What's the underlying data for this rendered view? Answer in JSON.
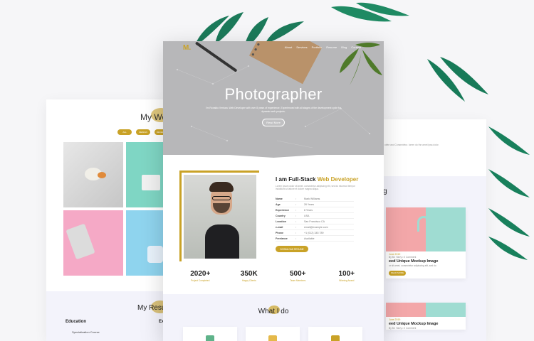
{
  "colors": {
    "accent": "#c9a227",
    "hero_bg": "#b7b7b9",
    "band": "#f3f3fb"
  },
  "main": {
    "logo": "M.",
    "nav": [
      "About",
      "Services",
      "Portfolio",
      "Resume",
      "Blog",
      "Contact"
    ],
    "hero": {
      "title": "Photographer",
      "subtitle": "I'm Ronaldo Ventura. Web Developer with over 8 years of experience. Experienced with all stages of the development cycle for dynamic web projects.",
      "button": "Read More"
    },
    "intro": {
      "title_prefix": "I am Full-Stack ",
      "title_highlight": "Web Developer",
      "text": "Lorem ipsum dolor sit amet, consectetur adipiscing elit, sed do eiusmod tempor incididunt ut labore et dolore magna aliqua.",
      "info": [
        {
          "k": "Name",
          "v": "Mark Williams"
        },
        {
          "k": "Age",
          "v": "26 Years"
        },
        {
          "k": "Experience",
          "v": "8 Years"
        },
        {
          "k": "Country",
          "v": "USA"
        },
        {
          "k": "Location",
          "v": "San Francisco CA"
        },
        {
          "k": "e-mail",
          "v": "email@example.com"
        },
        {
          "k": "Phone",
          "v": "+1 (012) 345 789"
        },
        {
          "k": "Freelance",
          "v": "Available"
        }
      ],
      "download": "DOWNLOAD RESUME"
    },
    "stats": [
      {
        "n": "2020+",
        "l": "Project Completed"
      },
      {
        "n": "350K",
        "l": "Happy Clients"
      },
      {
        "n": "500+",
        "l": "Team Members"
      },
      {
        "n": "100+",
        "l": "Winning Award"
      }
    ],
    "what_title": "What I do"
  },
  "left_page": {
    "portfolio_title": "My Wo",
    "filters": [
      "ALL",
      "DESIGN",
      "DEVELOP"
    ],
    "resume_title": "My Resu",
    "education": "Education",
    "edu_course": "Specialization Course",
    "exp_fragment": "Exp"
  },
  "right_page": {
    "intro_fragment": "olete and Consectetur. lorem do the amet ipsa dolor.",
    "blog_fragment": "g",
    "cards": [
      {
        "meta": "June 2019",
        "author": "By Mr. Harry   •   0 Comment",
        "title": "eed Unique Mockup Image",
        "text": "or sit amet, consectetur adipiscing elit, sed do",
        "button": "READ MORE"
      },
      {
        "meta": "June 2019",
        "author": "By Mr. Harry   •   0 Comment",
        "title": "eed Unique Mockup Image",
        "text": "",
        "button": ""
      }
    ]
  }
}
